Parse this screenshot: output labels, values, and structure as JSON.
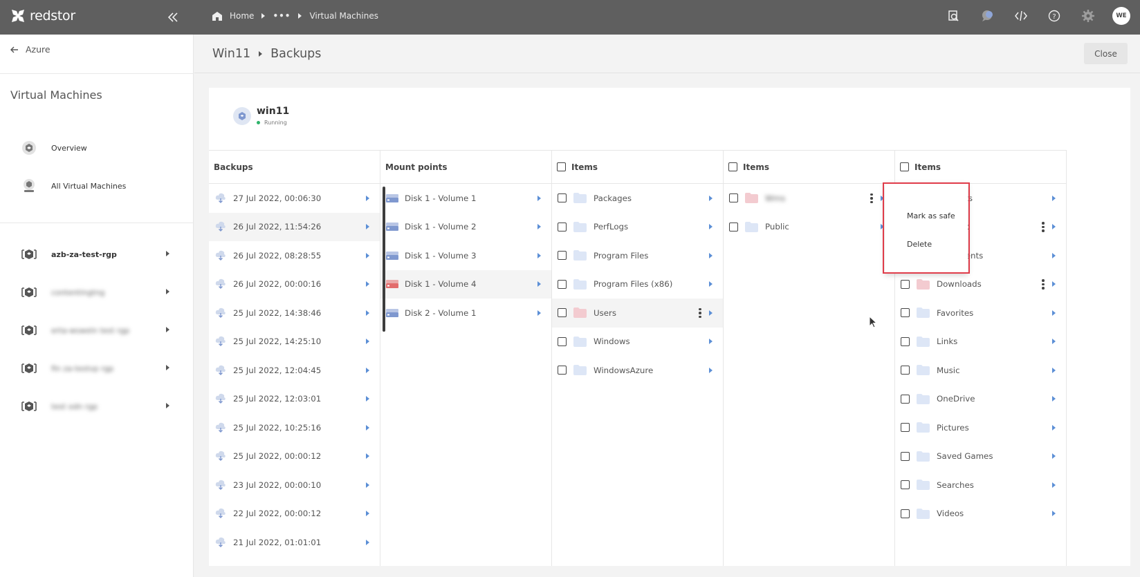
{
  "topbar": {
    "brand": "redstor",
    "breadcrumb": [
      "Home",
      "•••",
      "Virtual Machines"
    ],
    "avatar": "WE",
    "icons": [
      "search-icon",
      "chat-icon",
      "code-icon",
      "help-icon",
      "settings-icon"
    ]
  },
  "sidebar": {
    "back_label": "Azure",
    "title": "Virtual Machines",
    "nav": [
      {
        "label": "Overview",
        "icon": "overview-icon"
      },
      {
        "label": "All Virtual Machines",
        "icon": "vm-icon"
      }
    ],
    "groups": [
      {
        "label": "azb-za-test-rgp"
      },
      {
        "label": "contentingtng"
      },
      {
        "label": "erta-wsweln test rgp"
      },
      {
        "label": "fin za-testvp rgp"
      },
      {
        "label": "test odn rgp"
      }
    ]
  },
  "header": {
    "crumbs": [
      "Win11",
      "Backups"
    ],
    "close_label": "Close"
  },
  "vm": {
    "name": "win11",
    "status": "Running"
  },
  "columns": {
    "backups": {
      "title": "Backups",
      "items": [
        "27 Jul 2022, 00:06:30",
        "26 Jul 2022, 11:54:26",
        "26 Jul 2022, 08:28:55",
        "26 Jul 2022, 00:00:16",
        "25 Jul 2022, 14:38:46",
        "25 Jul 2022, 14:25:10",
        "25 Jul 2022, 12:04:45",
        "25 Jul 2022, 12:03:01",
        "25 Jul 2022, 10:25:16",
        "25 Jul 2022, 00:00:12",
        "23 Jul 2022, 00:00:10",
        "22 Jul 2022, 00:00:12",
        "21 Jul 2022, 01:01:01"
      ]
    },
    "mounts": {
      "title": "Mount points",
      "items": [
        "Disk 1 - Volume 1",
        "Disk 1 - Volume 2",
        "Disk 1 - Volume 3",
        "Disk 1 - Volume 4",
        "Disk 2 - Volume 1"
      ]
    },
    "items1": {
      "title": "Items",
      "items": [
        "Packages",
        "PerfLogs",
        "Program Files",
        "Program Files (x86)",
        "Users",
        "Windows",
        "WindowsAzure"
      ]
    },
    "items2": {
      "title": "Items",
      "items": [
        "Wms",
        "Public"
      ]
    },
    "items3": {
      "title": "Items",
      "items": [
        "Contacts",
        "Desktop",
        "Documents",
        "Downloads",
        "Favorites",
        "Links",
        "Music",
        "OneDrive",
        "Pictures",
        "Saved Games",
        "Searches",
        "Videos"
      ]
    }
  },
  "context_menu": {
    "items": [
      "Mark as safe",
      "Delete"
    ]
  },
  "colors": {
    "accent": "#5c8fd6",
    "highlight": "#e03c4a",
    "folder": "#dde6f6",
    "folder_flagged": "#f3cbd0",
    "disk": "#7f98cf",
    "disk_flagged": "#e26c6c"
  }
}
